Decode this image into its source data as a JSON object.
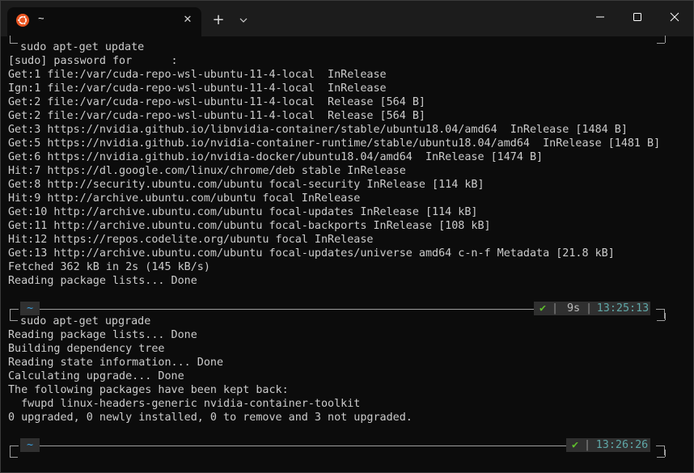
{
  "window": {
    "tab_title": "~",
    "tab_close_glyph": "✕",
    "new_tab_glyph": "+"
  },
  "colors": {
    "ubuntu_orange": "#e95420",
    "dir_blue": "#39a0e0",
    "check_green": "#5fbf2c",
    "time_teal": "#5fa8a8"
  },
  "icons": {
    "tab": "ubuntu-logo-icon",
    "minimize": "minimize-icon",
    "maximize": "maximize-icon",
    "close": "close-icon",
    "dropdown": "chevron-down-icon"
  },
  "terminal": {
    "block1": {
      "command": " sudo apt-get update",
      "output": [
        "[sudo] password for      :",
        "Get:1 file:/var/cuda-repo-wsl-ubuntu-11-4-local  InRelease",
        "Ign:1 file:/var/cuda-repo-wsl-ubuntu-11-4-local  InRelease",
        "Get:2 file:/var/cuda-repo-wsl-ubuntu-11-4-local  Release [564 B]",
        "Get:2 file:/var/cuda-repo-wsl-ubuntu-11-4-local  Release [564 B]",
        "Get:3 https://nvidia.github.io/libnvidia-container/stable/ubuntu18.04/amd64  InRelease [1484 B]",
        "Get:5 https://nvidia.github.io/nvidia-container-runtime/stable/ubuntu18.04/amd64  InRelease [1481 B]",
        "Get:6 https://nvidia.github.io/nvidia-docker/ubuntu18.04/amd64  InRelease [1474 B]",
        "Hit:7 https://dl.google.com/linux/chrome/deb stable InRelease",
        "Get:8 http://security.ubuntu.com/ubuntu focal-security InRelease [114 kB]",
        "Hit:9 http://archive.ubuntu.com/ubuntu focal InRelease",
        "Get:10 http://archive.ubuntu.com/ubuntu focal-updates InRelease [114 kB]",
        "Get:11 http://archive.ubuntu.com/ubuntu focal-backports InRelease [108 kB]",
        "Hit:12 https://repos.codelite.org/ubuntu focal InRelease",
        "Get:13 http://archive.ubuntu.com/ubuntu focal-updates/universe amd64 c-n-f Metadata [21.8 kB]",
        "Fetched 362 kB in 2s (145 kB/s)",
        "Reading package lists... Done"
      ]
    },
    "prompt1": {
      "dir": "~",
      "check": "✔",
      "separator": "|",
      "duration": "9s",
      "time": "13:25:13"
    },
    "block2": {
      "command": " sudo apt-get upgrade",
      "output": [
        "Reading package lists... Done",
        "Building dependency tree",
        "Reading state information... Done",
        "Calculating upgrade... Done",
        "The following packages have been kept back:",
        "  fwupd linux-headers-generic nvidia-container-toolkit",
        "0 upgraded, 0 newly installed, 0 to remove and 3 not upgraded."
      ]
    },
    "prompt2": {
      "dir": "~",
      "check": "✔",
      "separator": "|",
      "time": "13:26:26"
    }
  }
}
